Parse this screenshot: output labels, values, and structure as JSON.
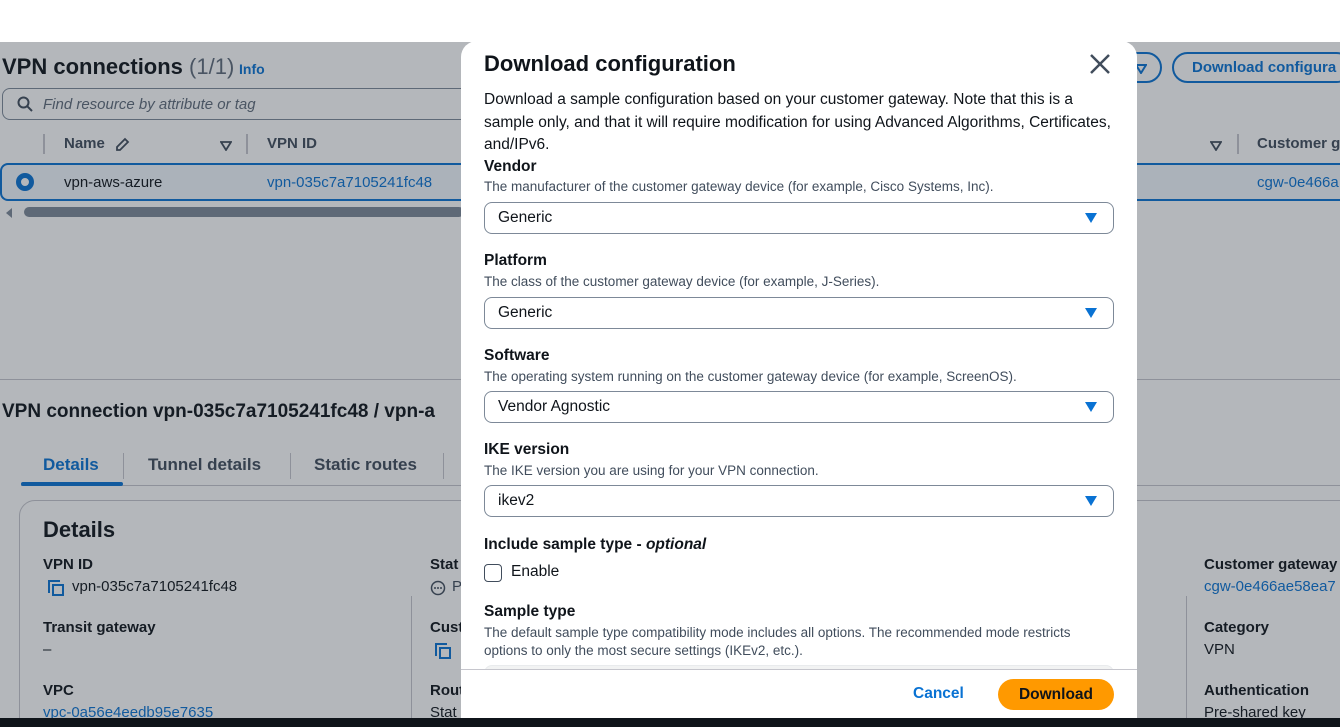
{
  "list": {
    "title": "VPN connections",
    "count": "(1/1)",
    "info": "Info",
    "search_placeholder": "Find resource by attribute or tag",
    "actions_button": "Download configura",
    "columns": {
      "name": "Name",
      "vpn_id": "VPN ID",
      "customer_gateway": "Customer g"
    },
    "row": {
      "name": "vpn-aws-azure",
      "vpn_id": "vpn-035c7a7105241fc48",
      "customer_gateway": "cgw-0e466a"
    }
  },
  "detail": {
    "heading": "VPN connection vpn-035c7a7105241fc48 / vpn-a",
    "tabs": [
      "Details",
      "Tunnel details",
      "Static routes"
    ],
    "panel_title": "Details",
    "fields": {
      "vpn_id_label": "VPN ID",
      "vpn_id_value": "vpn-035c7a7105241fc48",
      "transit_gateway_label": "Transit gateway",
      "transit_gateway_value": "–",
      "vpc_label": "VPC",
      "vpc_value": "vpc-0a56e4eedb95e7635",
      "state_label": "Stat",
      "state_value": "P",
      "customer_label": "Cust",
      "route_label": "Rout",
      "route_value": "Stat",
      "customer_gateway_label": "Customer gateway",
      "customer_gateway_value": "cgw-0e466ae58ea7",
      "category_label": "Category",
      "category_value": "VPN",
      "authentication_label": "Authentication",
      "authentication_value": "Pre-shared key"
    }
  },
  "modal": {
    "title": "Download configuration",
    "intro": "Download a sample configuration based on your customer gateway. Note that this is a sample only, and that it will require modification for using Advanced Algorithms, Certificates, and/IPv6.",
    "vendor": {
      "label": "Vendor",
      "description": "The manufacturer of the customer gateway device (for example, Cisco Systems, Inc).",
      "value": "Generic"
    },
    "platform": {
      "label": "Platform",
      "description": "The class of the customer gateway device (for example, J-Series).",
      "value": "Generic"
    },
    "software": {
      "label": "Software",
      "description": "The operating system running on the customer gateway device (for example, ScreenOS).",
      "value": "Vendor Agnostic"
    },
    "ike": {
      "label": "IKE version",
      "description": "The IKE version you are using for your VPN connection.",
      "value": "ikev2"
    },
    "include_sample": {
      "label": "Include sample type -",
      "optional": "optional",
      "checkbox_label": "Enable",
      "checked": false
    },
    "sample_type": {
      "label": "Sample type",
      "description": "The default sample type compatibility mode includes all options. The recommended mode restricts options to only the most secure settings (IKEv2, etc.)."
    },
    "cancel_label": "Cancel",
    "download_label": "Download"
  },
  "colors": {
    "accent": "#0972d3",
    "primary_button": "#ff9900",
    "text": "#0f141a"
  }
}
